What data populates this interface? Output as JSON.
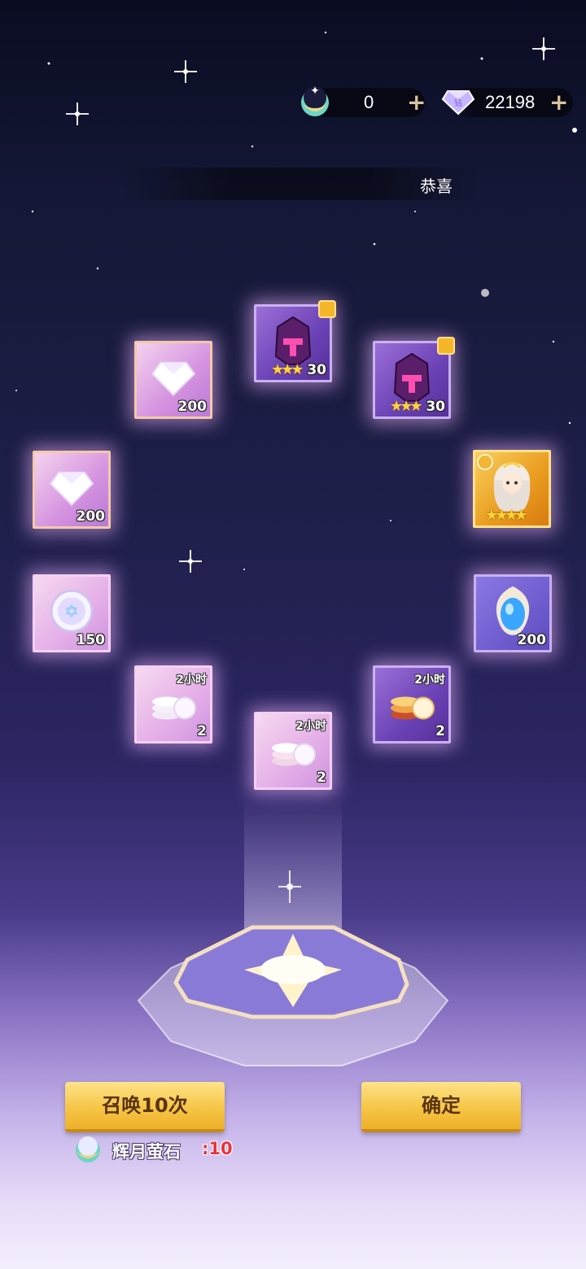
{
  "currency": {
    "moonstone_amount": "0",
    "diamond_amount": "22198"
  },
  "banner": {
    "text": "恭喜"
  },
  "rewards": [
    {
      "kind": "diamond",
      "count": "200"
    },
    {
      "kind": "helmet-fragment",
      "count": "30",
      "stars": "★★★"
    },
    {
      "kind": "helmet-fragment",
      "count": "30",
      "stars": "★★★"
    },
    {
      "kind": "diamond",
      "count": "200"
    },
    {
      "kind": "hero",
      "stars": "★★★★"
    },
    {
      "kind": "star-coin",
      "count": "150"
    },
    {
      "kind": "blue-crystal",
      "count": "200"
    },
    {
      "kind": "silver-coins",
      "count": "2",
      "duration": "2小时"
    },
    {
      "kind": "silver-coins",
      "count": "2",
      "duration": "2小时"
    },
    {
      "kind": "gold-coins",
      "count": "2",
      "duration": "2小时"
    }
  ],
  "buttons": {
    "summon_label": "召唤10次",
    "confirm_label": "确定"
  },
  "cost": {
    "item_label": "辉月萤石",
    "value": ":10"
  },
  "colors": {
    "button_gold": "#f6c646",
    "cost_red": "#e8323a",
    "card_glow": "#eeb4ff"
  }
}
